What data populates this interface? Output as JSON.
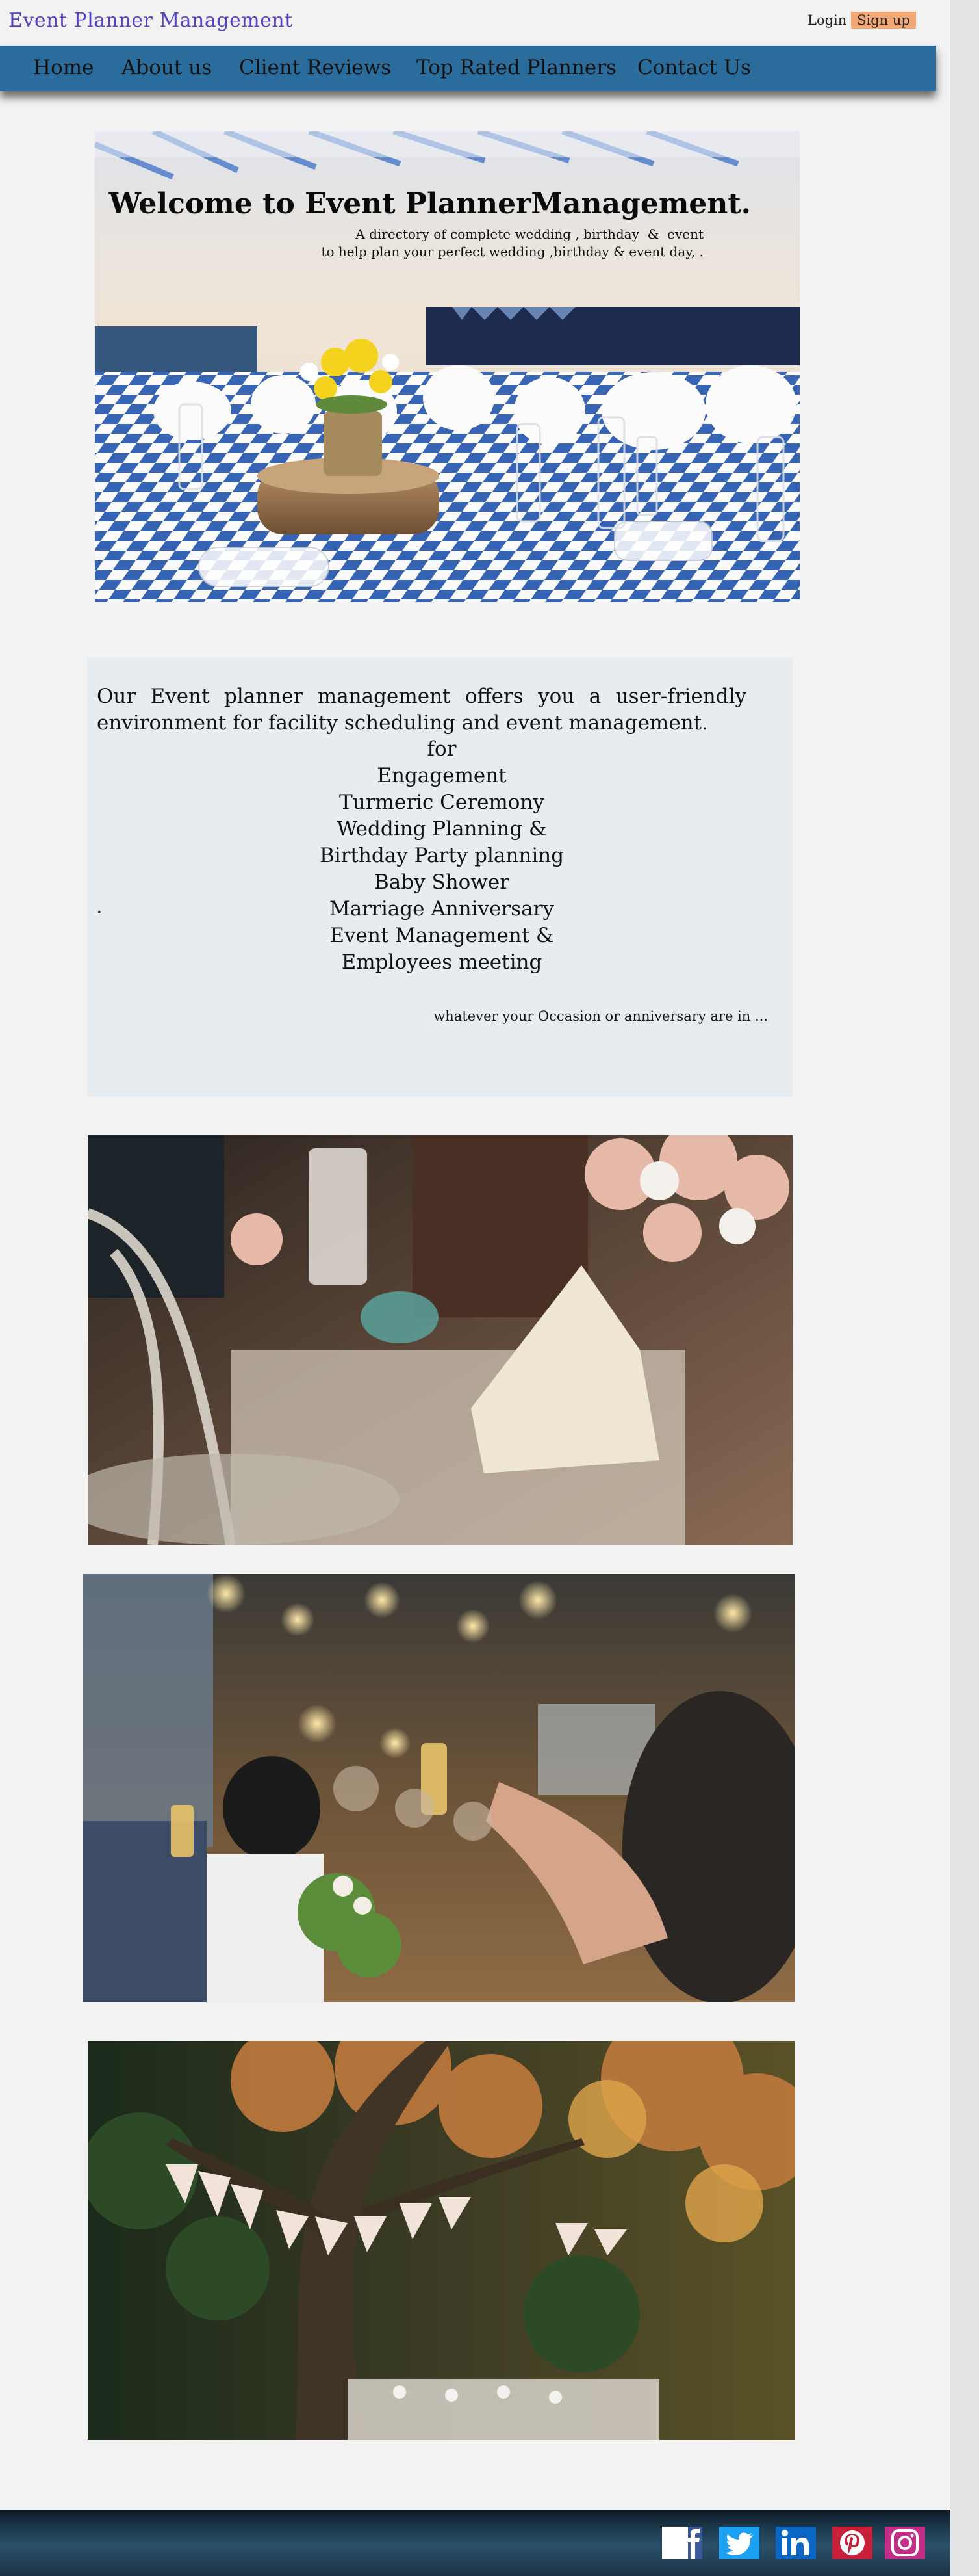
{
  "header": {
    "brand": "Event Planner Management",
    "login_label": "Login",
    "signup_label": "Sign up"
  },
  "nav": {
    "items": [
      "Home",
      "About us",
      "Client Reviews",
      "Top Rated Planners",
      "Contact Us"
    ]
  },
  "hero": {
    "title": "Welcome to Event PlannerManagement.",
    "subtitle": "A directory of complete wedding , birthday  &  event\nto help plan your perfect wedding ,birthday & event day, ."
  },
  "about": {
    "intro": "Our Event planner management offers you a user-friendly environment for facility scheduling and event management.",
    "occasions": [
      "for",
      "Engagement",
      "Turmeric Ceremony",
      "Wedding Planning &",
      "Birthday Party planning",
      "Baby Shower",
      "Marriage Anniversary",
      "Event Management &",
      "Employees meeting"
    ],
    "dot": ".",
    "closing": "whatever your Occasion or anniversary are in ..."
  },
  "footer": {
    "social_icons": [
      "facebook-icon",
      "twitter-icon",
      "linkedin-icon",
      "pinterest-icon",
      "instagram-icon"
    ]
  },
  "colors": {
    "brand": "#5144c9",
    "nav_bar": "#2a6d9c",
    "signup": "#f2a874",
    "panel": "#e6ecef",
    "footer": "#1e3a4e",
    "pinterest": "#c8203a",
    "instagram": "#c12f86"
  }
}
